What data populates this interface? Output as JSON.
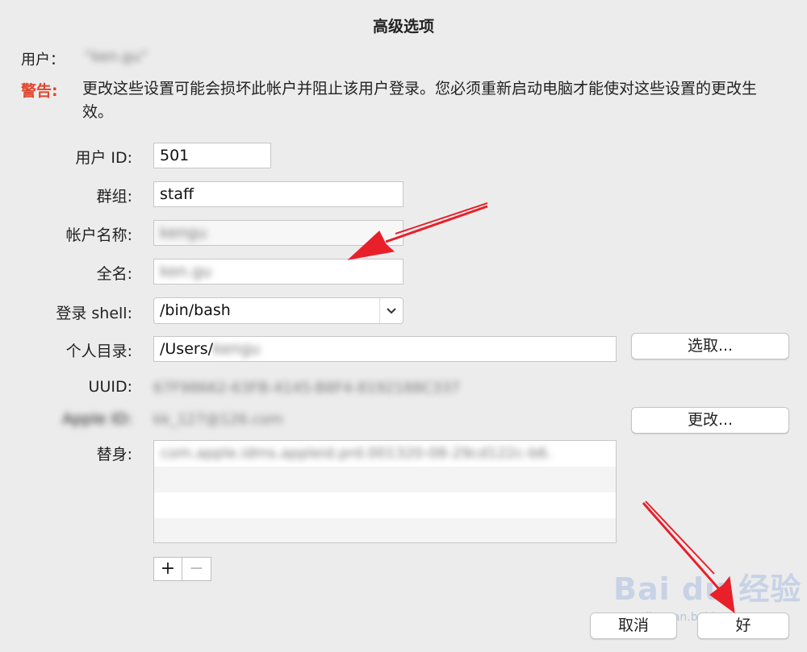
{
  "dialog": {
    "title": "高级选项",
    "user_label": "用户：",
    "user_value": "“ken.gu”",
    "warning_label": "警告:",
    "warning_text": "更改这些设置可能会损坏此帐户并阻止该用户登录。您必须重新启动电脑才能使对这些设置的更改生效。"
  },
  "fields": {
    "user_id": {
      "label": "用户 ID:",
      "value": "501"
    },
    "group": {
      "label": "群组:",
      "value": "staff"
    },
    "account_name": {
      "label": "帐户名称:",
      "value": "kengu"
    },
    "full_name": {
      "label": "全名:",
      "value": "ken.gu"
    },
    "login_shell": {
      "label": "登录 shell:",
      "value": "/bin/bash"
    },
    "home_dir": {
      "label": "个人目录:",
      "value_prefix": "/Users/",
      "value_blurred": "kengu",
      "choose_button": "选取..."
    },
    "uuid": {
      "label": "UUID:",
      "value": "67F98662-63FB-4145-B8F4-8192188C337"
    },
    "apple_id": {
      "label": "Apple ID:",
      "value": "kk_127@126.com",
      "change_button": "更改..."
    },
    "aliases": {
      "label": "替身:",
      "items": [
        "com.apple.idms.appleid.prd.001320-08-29cd122c-b6."
      ]
    }
  },
  "alias_controls": {
    "add": "+",
    "remove": "−"
  },
  "footer": {
    "cancel": "取消",
    "ok": "好"
  },
  "watermark": {
    "main": "Bai du 经验",
    "sub": "jingyan.baidu.com"
  },
  "colors": {
    "warning": "#e0452e",
    "arrow": "#e8202a"
  },
  "icons": {
    "select_arrow": "chevron-down-icon"
  }
}
